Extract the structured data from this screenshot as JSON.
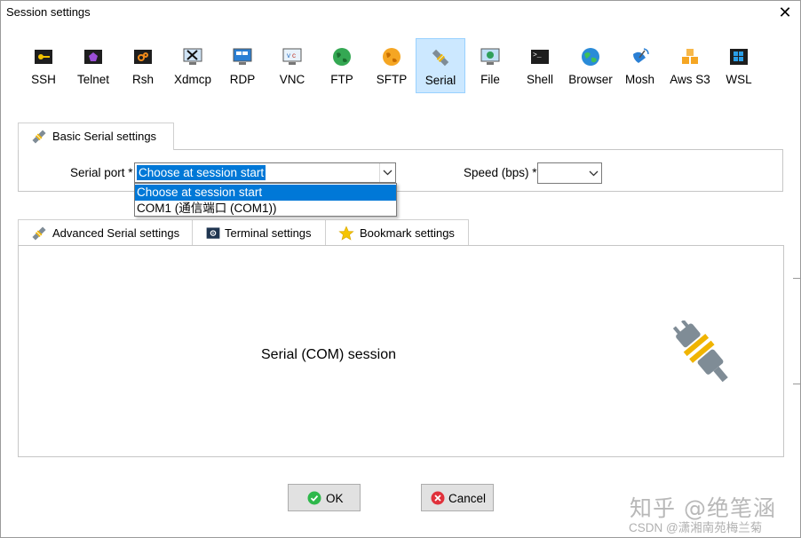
{
  "window": {
    "title": "Session settings",
    "close_glyph": "✕"
  },
  "session_types": [
    {
      "label": "SSH",
      "icon": "ssh-key-icon"
    },
    {
      "label": "Telnet",
      "icon": "telnet-icon"
    },
    {
      "label": "Rsh",
      "icon": "rsh-icon"
    },
    {
      "label": "Xdmcp",
      "icon": "xdmcp-icon"
    },
    {
      "label": "RDP",
      "icon": "rdp-monitor-icon"
    },
    {
      "label": "VNC",
      "icon": "vnc-monitor-icon"
    },
    {
      "label": "FTP",
      "icon": "ftp-globe-icon"
    },
    {
      "label": "SFTP",
      "icon": "sftp-globe-icon"
    },
    {
      "label": "Serial",
      "icon": "serial-plug-icon",
      "selected": true
    },
    {
      "label": "File",
      "icon": "file-monitor-icon"
    },
    {
      "label": "Shell",
      "icon": "shell-terminal-icon"
    },
    {
      "label": "Browser",
      "icon": "browser-globe-icon"
    },
    {
      "label": "Mosh",
      "icon": "mosh-satellite-icon"
    },
    {
      "label": "Aws S3",
      "icon": "aws-s3-cubes-icon"
    },
    {
      "label": "WSL",
      "icon": "wsl-windows-icon"
    }
  ],
  "basic_tab": {
    "label": "Basic Serial settings",
    "icon": "serial-plug-icon"
  },
  "serial_port": {
    "label": "Serial port *",
    "value": "Choose at session start",
    "options": [
      "Choose at session start",
      "COM1  (通信端口 (COM1))"
    ]
  },
  "speed": {
    "label": "Speed (bps) *",
    "value": ""
  },
  "sub_tabs": [
    {
      "label": "Advanced Serial settings",
      "icon": "serial-plug-icon"
    },
    {
      "label": "Terminal settings",
      "icon": "terminal-settings-icon"
    },
    {
      "label": "Bookmark settings",
      "icon": "star-icon"
    }
  ],
  "content": {
    "description": "Serial (COM) session",
    "illustration": "serial-plug-illustration"
  },
  "buttons": {
    "ok": {
      "label": "OK",
      "icon": "check-circle-icon"
    },
    "cancel": {
      "label": "Cancel",
      "icon": "cancel-circle-icon"
    }
  },
  "watermark": {
    "line1": "知乎 @绝笔涵",
    "line2": "CSDN @潇湘南苑梅兰菊"
  },
  "colors": {
    "selection": "#0078d7",
    "selected_tool_bg": "#cce8ff",
    "ok_green": "#2eb84b",
    "cancel_red": "#e0313b",
    "star_yellow": "#f5c400"
  }
}
